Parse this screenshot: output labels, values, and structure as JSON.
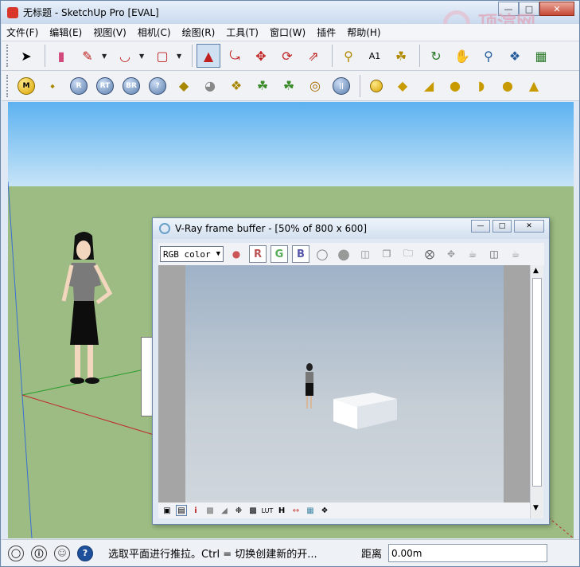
{
  "window": {
    "title": "无标题 - SketchUp Pro [EVAL]"
  },
  "watermark": {
    "text": "顶渲网"
  },
  "menu": [
    "文件(F)",
    "编辑(E)",
    "视图(V)",
    "相机(C)",
    "绘图(R)",
    "工具(T)",
    "窗口(W)",
    "插件",
    "帮助(H)"
  ],
  "toolbar2": {
    "m": "M",
    "r": "R",
    "rt": "RT",
    "br": "BR",
    "q": "?"
  },
  "vray": {
    "title": "V-Ray frame buffer - [50% of 800 x 600]",
    "channel": "RGB color",
    "r": "R",
    "g": "G",
    "b": "B",
    "status_i": "i",
    "status_h": "H"
  },
  "status": {
    "hint": "选取平面进行推拉。Ctrl = 切换创建新的开...",
    "distance_label": "距离",
    "distance_value": "0.00m"
  },
  "colors": {
    "sky_top": "#5db2f0",
    "ground": "#9cbc83",
    "accent": "#d9362b"
  }
}
